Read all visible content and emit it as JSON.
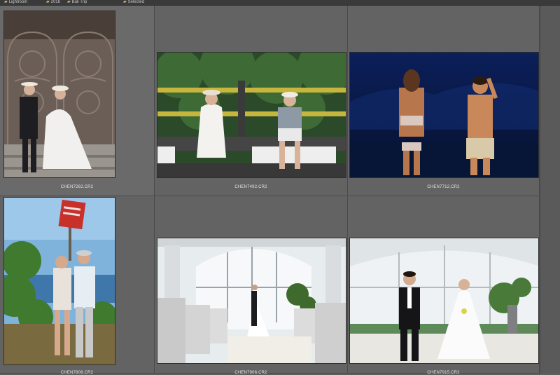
{
  "breadcrumbs": [
    {
      "label": "Lightroom",
      "icon": "folder-icon"
    },
    {
      "label": "2016",
      "icon": "folder-icon"
    },
    {
      "label": "Bali Trip",
      "icon": "folder-icon"
    },
    {
      "label": "Selected",
      "icon": "folder-icon"
    }
  ],
  "thumbnails": [
    {
      "filename": "CHEN7262.CR2",
      "subject": "couple-gate"
    },
    {
      "filename": "CHEN7492.CR2",
      "subject": "couple-railing"
    },
    {
      "filename": "CHEN7712.CR2",
      "subject": "couple-night-beach"
    },
    {
      "filename": "CHEN7806.CR2",
      "subject": "couple-cliff-sign"
    },
    {
      "filename": "CHEN7906.CR2",
      "subject": "chapel-aisle"
    },
    {
      "filename": "CHEN7915.CR2",
      "subject": "chapel-portrait"
    }
  ],
  "colors": {
    "background": "#5f5f5f",
    "cell": "#636363",
    "caption": "#e4e4e4"
  }
}
